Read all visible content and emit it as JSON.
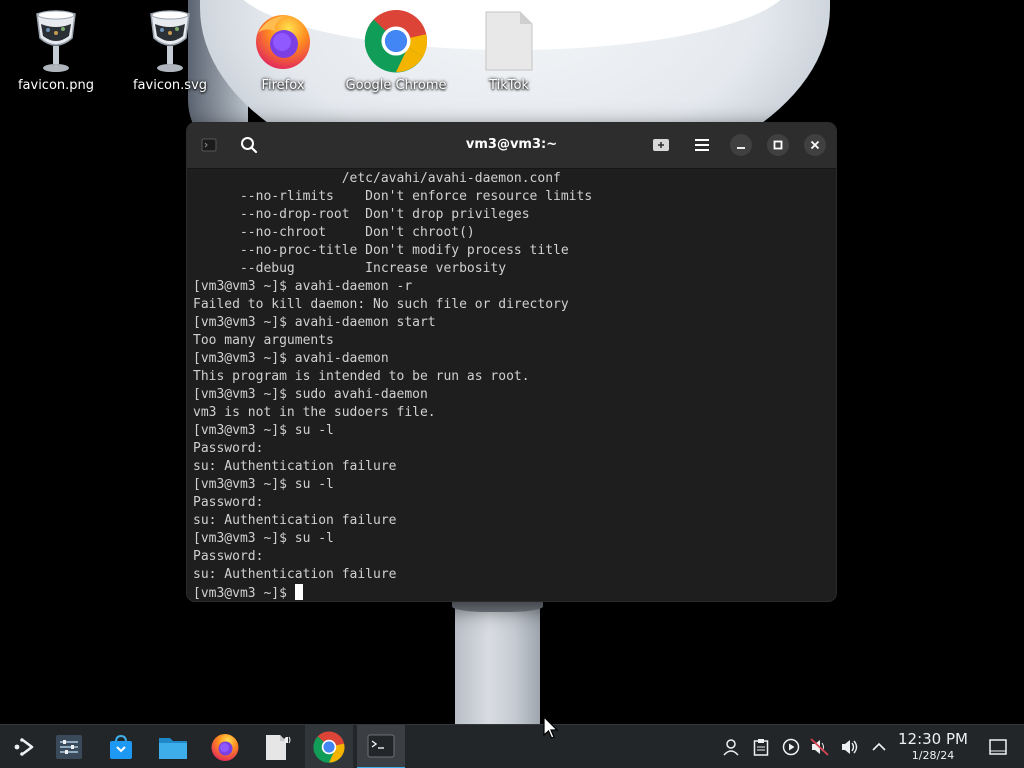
{
  "desktop": {
    "icons": [
      {
        "label": "favicon.png",
        "icon": "goblet-image-icon"
      },
      {
        "label": "favicon.svg",
        "icon": "goblet-image-icon"
      },
      {
        "label": "Firefox",
        "icon": "firefox-icon"
      },
      {
        "label": "Google Chrome",
        "icon": "chrome-icon"
      },
      {
        "label": "TikTok",
        "icon": "blank-file-icon"
      }
    ]
  },
  "terminal": {
    "title": "vm3@vm3:~",
    "lines": [
      "                   /etc/avahi/avahi-daemon.conf",
      "      --no-rlimits    Don't enforce resource limits",
      "      --no-drop-root  Don't drop privileges",
      "      --no-chroot     Don't chroot()",
      "      --no-proc-title Don't modify process title",
      "      --debug         Increase verbosity",
      "[vm3@vm3 ~]$ avahi-daemon -r",
      "Failed to kill daemon: No such file or directory",
      "[vm3@vm3 ~]$ avahi-daemon start",
      "Too many arguments",
      "[vm3@vm3 ~]$ avahi-daemon",
      "This program is intended to be run as root.",
      "[vm3@vm3 ~]$ sudo avahi-daemon",
      "vm3 is not in the sudoers file.",
      "[vm3@vm3 ~]$ su -l",
      "Password:",
      "su: Authentication failure",
      "[vm3@vm3 ~]$ su -l",
      "Password:",
      "su: Authentication failure",
      "[vm3@vm3 ~]$ su -l",
      "Password:",
      "su: Authentication failure"
    ],
    "prompt": "[vm3@vm3 ~]$ "
  },
  "taskbar": {
    "items": [
      {
        "icon": "application-launcher-icon"
      },
      {
        "icon": "system-settings-icon"
      },
      {
        "icon": "discover-store-icon"
      },
      {
        "icon": "file-manager-icon"
      },
      {
        "icon": "firefox-icon"
      },
      {
        "icon": "file-audio-icon"
      },
      {
        "icon": "chrome-icon"
      },
      {
        "icon": "terminal-icon"
      }
    ],
    "tray": [
      {
        "icon": "user-icon"
      },
      {
        "icon": "clipboard-icon"
      },
      {
        "icon": "media-player-icon"
      },
      {
        "icon": "audio-muted-icon"
      },
      {
        "icon": "volume-icon"
      },
      {
        "icon": "chevron-up-icon"
      }
    ],
    "clock": {
      "time": "12:30 PM",
      "date": "1/28/24"
    }
  },
  "colors": {
    "terminal_bg": "#1e1e1e",
    "titlebar_bg": "#2d2d2d",
    "taskbar_bg": "#232629",
    "accent": "#3daee9"
  }
}
